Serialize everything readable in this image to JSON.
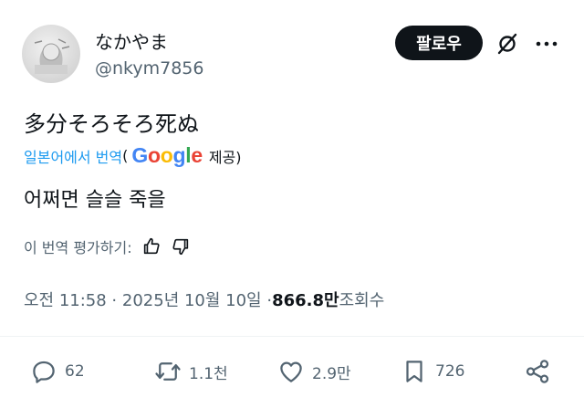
{
  "user": {
    "display_name": "なかやま",
    "handle": "@nkym7856"
  },
  "header": {
    "follow_label": "팔로우"
  },
  "tweet": {
    "text": "多分そろそろ死ぬ"
  },
  "translation": {
    "label": "일본어에서 번역",
    "paren_open": "(",
    "provider": "Google",
    "provided": "제공)",
    "text": "어쩌면 슬슬 죽을"
  },
  "rating": {
    "label": "이 번역 평가하기:"
  },
  "meta": {
    "time": "오전 11:58 · 2025년 10월 10일 · ",
    "views_count": "866.8만",
    "views_label": " 조회수"
  },
  "actions": {
    "replies": "62",
    "reposts": "1.1천",
    "likes": "2.9만",
    "bookmarks": "726"
  },
  "colors": {
    "link": "#1d9bf0",
    "muted": "#536471",
    "text": "#0f1419",
    "google_blue": "#4285F4",
    "google_red": "#EA4335",
    "google_yellow": "#FBBC05",
    "google_green": "#34A853"
  }
}
